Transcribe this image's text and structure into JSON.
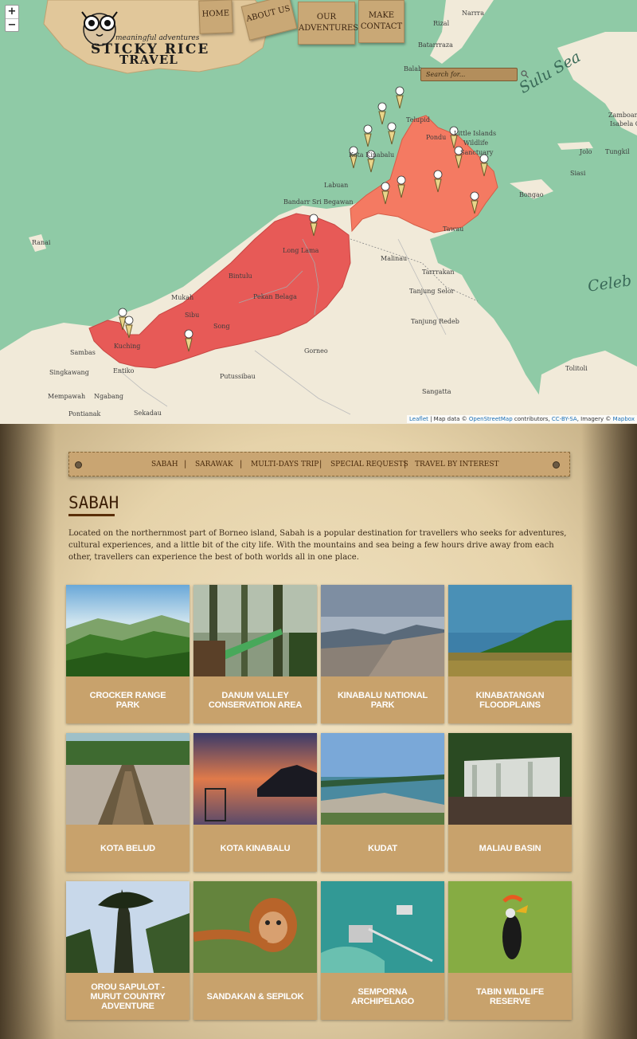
{
  "brand": {
    "tagline": "meaningful adventures",
    "name_line1": "STICKY RICE",
    "name_line2": "TRAVEL"
  },
  "map_controls": {
    "zoom_in": "+",
    "zoom_out": "−"
  },
  "top_nav": [
    {
      "label": "HOME"
    },
    {
      "label": "ABOUT US"
    },
    {
      "label": "OUR ADVENTURES"
    },
    {
      "label": "MAKE CONTACT"
    }
  ],
  "map_search": {
    "placeholder": "Search for..."
  },
  "map_labels": {
    "sulu_sea": "Sulu Sea",
    "celebes": "Celeb",
    "narrra": "Narrra",
    "rizal": "Rizal",
    "batarrraza": "Batarrraza",
    "balab": "Balab",
    "telupid": "Telupid",
    "pondu": "Pondu",
    "little_islands": "Little Islands",
    "wildlife": "Wildlife",
    "sanctuary": "Sanctuary",
    "kota_kinabalu": "Kota Kinabalu",
    "labuan": "Labuan",
    "bandar": "Bandarr Sri Begawan",
    "long_lama": "Long Lama",
    "bintulu": "Bintulu",
    "mukah": "Mukah",
    "sibu": "Sibu",
    "pekan": "Pekan Belaga",
    "song": "Song",
    "kuching": "Kuching",
    "sambas": "Sambas",
    "singkawang": "Singkawang",
    "mempawah": "Mempawah",
    "ngabang": "Ngabang",
    "pontianak": "Pontianak",
    "sekadau": "Sekadau",
    "entikong": "Entiko",
    "putussibau": "Putussibau",
    "gorneo": "Gorneo",
    "malinau": "Malinau",
    "tarrakan": "Tarrrakan",
    "tanjung_selor": "Tanjung Selor",
    "tanjung_redeb": "Tanjung Redeb",
    "sangatta": "Sangatta",
    "tolitoli": "Tolitoli",
    "tawau": "Tawau",
    "bongao": "Bongao",
    "jolo": "Jolo",
    "siasi": "Siasi",
    "tungkil": "Tungkil",
    "zamboanga": "Zamboanga",
    "isabela": "Isabela Ci",
    "ranai": "Ranai"
  },
  "attribution": {
    "leaflet": "Leaflet",
    "text1": " | Map data © ",
    "osm": "OpenStreetMap",
    "text2": " contributors, ",
    "ccbysa": "CC-BY-SA",
    "text3": ", Imagery © ",
    "mapbox": "Mapbox"
  },
  "sub_nav": [
    "SABAH",
    "SARAWAK",
    "MULTI-DAYS TRIP",
    "SPECIAL REQUESTS",
    "TRAVEL BY INTEREST"
  ],
  "section": {
    "title": "SABAH",
    "intro": "Located on the northernmost part of Borneo island, Sabah is a popular destination for travellers who seeks for adventures, cultural experiences, and a little bit of the city life. With the mountains and sea being a few hours drive away from each other, travellers can experience the best of both worlds all in one place."
  },
  "destinations": [
    {
      "line1": "CROCKER RANGE",
      "line2": "PARK",
      "line3": ""
    },
    {
      "line1": "DANUM VALLEY",
      "line2": "CONSERVATION AREA",
      "line3": ""
    },
    {
      "line1": "KINABALU NATIONAL",
      "line2": "PARK",
      "line3": ""
    },
    {
      "line1": "KINABATANGAN",
      "line2": "FLOODPLAINS",
      "line3": ""
    },
    {
      "line1": "KOTA BELUD",
      "line2": "",
      "line3": ""
    },
    {
      "line1": "KOTA KINABALU",
      "line2": "",
      "line3": ""
    },
    {
      "line1": "KUDAT",
      "line2": "",
      "line3": ""
    },
    {
      "line1": "MALIAU BASIN",
      "line2": "",
      "line3": ""
    },
    {
      "line1": "OROU SAPULOT -",
      "line2": "MURUT COUNTRY",
      "line3": "ADVENTURE"
    },
    {
      "line1": "SANDAKAN & SEPILOK",
      "line2": "",
      "line3": ""
    },
    {
      "line1": "SEMPORNA",
      "line2": "ARCHIPELAGO",
      "line3": ""
    },
    {
      "line1": "TABIN WILDLIFE",
      "line2": "RESERVE",
      "line3": ""
    }
  ]
}
